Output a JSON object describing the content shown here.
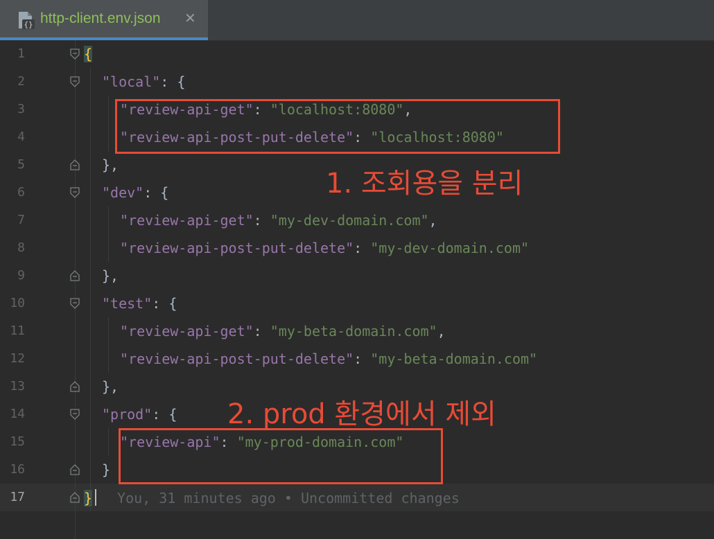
{
  "tab": {
    "title": "http-client.env.json",
    "close_glyph": "✕"
  },
  "editor": {
    "lines": [
      {
        "num": "1"
      },
      {
        "num": "2"
      },
      {
        "num": "3"
      },
      {
        "num": "4"
      },
      {
        "num": "5"
      },
      {
        "num": "6"
      },
      {
        "num": "7"
      },
      {
        "num": "8"
      },
      {
        "num": "9"
      },
      {
        "num": "10"
      },
      {
        "num": "11"
      },
      {
        "num": "12"
      },
      {
        "num": "13"
      },
      {
        "num": "14"
      },
      {
        "num": "15"
      },
      {
        "num": "16"
      },
      {
        "num": "17"
      }
    ],
    "tokens": {
      "open_brace": "{",
      "close_brace": "}",
      "local_key": "\"local\"",
      "dev_key": "\"dev\"",
      "test_key": "\"test\"",
      "prod_key": "\"prod\"",
      "get_key": "\"review-api-get\"",
      "ppd_key": "\"review-api-post-put-delete\"",
      "api_key": "\"review-api\"",
      "local_val": "\"localhost:8080\"",
      "dev_val": "\"my-dev-domain.com\"",
      "beta_val": "\"my-beta-domain.com\"",
      "prod_val": "\"my-prod-domain.com\"",
      "colon_open": ": {",
      "colon": ": ",
      "comma": ",",
      "close_comma": "},"
    },
    "blame_hint": "You, 31 minutes ago • Uncommitted changes"
  },
  "annotations": {
    "note1": "1. 조회용을 분리",
    "note2": "2. prod 환경에서 제외"
  },
  "colors": {
    "background": "#2b2b2b",
    "key": "#9876aa",
    "string": "#6a8759",
    "annotation": "#e84b36",
    "tab_accent": "#4a88c7"
  }
}
